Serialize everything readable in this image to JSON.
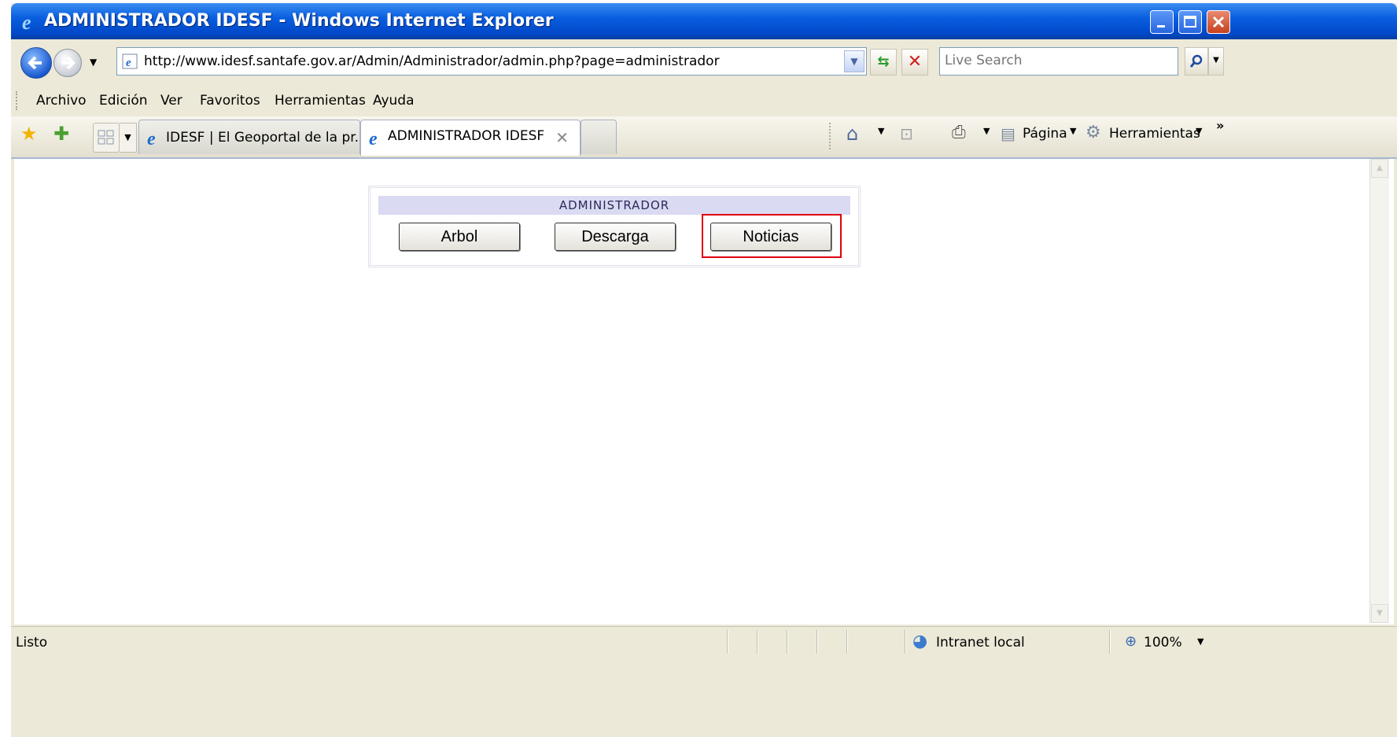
{
  "window": {
    "title": "ADMINISTRADOR IDESF - Windows Internet Explorer"
  },
  "address_bar": {
    "url": "http://www.idesf.santafe.gov.ar/Admin/Administrador/admin.php?page=administrador",
    "search_placeholder": "Live Search"
  },
  "menu": {
    "items": [
      "Archivo",
      "Edición",
      "Ver",
      "Favoritos",
      "Herramientas",
      "Ayuda"
    ]
  },
  "tabs": [
    {
      "label": "IDESF | El Geoportal de la pr...",
      "active": false
    },
    {
      "label": "ADMINISTRADOR IDESF",
      "active": true
    }
  ],
  "command_bar": {
    "page_label": "Página",
    "tools_label": "Herramientas"
  },
  "admin_panel": {
    "header": "ADMINISTRADOR",
    "buttons": [
      "Arbol",
      "Descarga",
      "Noticias"
    ],
    "highlighted_button": "Noticias",
    "highlight_color": "#e0000f"
  },
  "status_bar": {
    "status": "Listo",
    "zone": "Intranet local",
    "zoom": "100%"
  },
  "icons": [
    "ie-icon",
    "back-icon",
    "forward-icon",
    "refresh-icon",
    "stop-icon",
    "search-icon",
    "favorites-star-icon",
    "add-favorite-icon",
    "quick-tabs-icon",
    "home-icon",
    "feeds-icon",
    "print-icon",
    "page-icon",
    "tools-gear-icon",
    "intranet-globe-icon",
    "zoom-icon"
  ]
}
